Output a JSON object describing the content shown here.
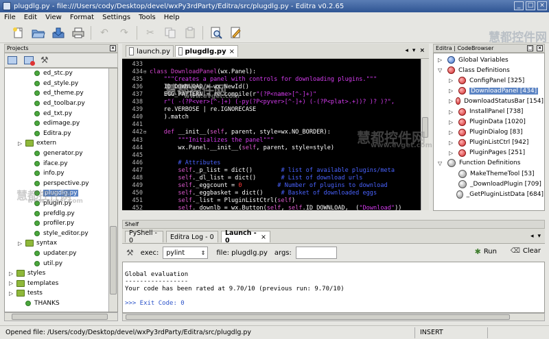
{
  "window": {
    "title": "plugdlg.py - file:///Users/cody/Desktop/devel/wxPy3rdParty/Editra/src/plugdlg.py - Editra v0.2.65"
  },
  "menu": [
    "File",
    "Edit",
    "View",
    "Format",
    "Settings",
    "Tools",
    "Help"
  ],
  "toolbar": {
    "icons": [
      "new-file-icon",
      "open-folder-icon",
      "save-icon",
      "print-icon",
      "undo-icon",
      "redo-icon",
      "cut-icon",
      "copy-icon",
      "paste-icon",
      "find-icon",
      "find-replace-icon"
    ]
  },
  "projects": {
    "title": "Projects",
    "items": [
      {
        "label": "ed_stc.py",
        "type": "py",
        "indent": 3
      },
      {
        "label": "ed_style.py",
        "type": "py",
        "indent": 3
      },
      {
        "label": "ed_theme.py",
        "type": "py",
        "indent": 3
      },
      {
        "label": "ed_toolbar.py",
        "type": "py",
        "indent": 3
      },
      {
        "label": "ed_txt.py",
        "type": "py",
        "indent": 3
      },
      {
        "label": "edimage.py",
        "type": "py",
        "indent": 3
      },
      {
        "label": "Editra.py",
        "type": "py",
        "indent": 3
      },
      {
        "label": "extern",
        "type": "folder",
        "indent": 2
      },
      {
        "label": "generator.py",
        "type": "py",
        "indent": 3
      },
      {
        "label": "iface.py",
        "type": "py",
        "indent": 3
      },
      {
        "label": "info.py",
        "type": "py",
        "indent": 3
      },
      {
        "label": "perspective.py",
        "type": "py",
        "indent": 3
      },
      {
        "label": "plugdlg.py",
        "type": "py",
        "indent": 3,
        "selected": true
      },
      {
        "label": "plugin.py",
        "type": "py",
        "indent": 3
      },
      {
        "label": "prefdlg.py",
        "type": "py",
        "indent": 3
      },
      {
        "label": "profiler.py",
        "type": "py",
        "indent": 3
      },
      {
        "label": "style_editor.py",
        "type": "py",
        "indent": 3
      },
      {
        "label": "syntax",
        "type": "folder",
        "indent": 2
      },
      {
        "label": "updater.py",
        "type": "py",
        "indent": 3
      },
      {
        "label": "util.py",
        "type": "py",
        "indent": 3
      },
      {
        "label": "styles",
        "type": "folder",
        "indent": 1
      },
      {
        "label": "templates",
        "type": "folder",
        "indent": 1
      },
      {
        "label": "tests",
        "type": "folder",
        "indent": 1
      },
      {
        "label": "THANKS",
        "type": "py",
        "indent": 2
      }
    ]
  },
  "editor": {
    "tabs": [
      {
        "label": "launch.py",
        "active": false
      },
      {
        "label": "plugdlg.py",
        "active": true
      }
    ],
    "lines": [
      {
        "n": "433",
        "segs": []
      },
      {
        "n": "434",
        "fold": "⊟",
        "segs": [
          {
            "c": "kw",
            "t": "class "
          },
          {
            "c": "kw",
            "t": "DownloadPanel"
          },
          {
            "c": "pl",
            "t": "(wx.Panel):"
          }
        ]
      },
      {
        "n": "435",
        "segs": [
          {
            "c": "str",
            "t": "    \"\"\"Creates a panel with controls for downloading plugins.\"\"\""
          }
        ]
      },
      {
        "n": "436",
        "segs": [
          {
            "c": "pl",
            "t": "    ID_DOWNLOAD = wx.NewId()"
          }
        ]
      },
      {
        "n": "437",
        "segs": [
          {
            "c": "pl",
            "t": "    EGG_PATTERN = re.compile(r"
          },
          {
            "c": "str",
            "t": "\"(?P<name>[^-]+)\""
          }
        ]
      },
      {
        "n": "438",
        "segs": [
          {
            "c": "str",
            "t": "    r\"( -(?P<ver>[^-]+) (-py(?P<pyver>[^-]+) (-(?P<plat>.+))? )? )?\","
          }
        ]
      },
      {
        "n": "439",
        "segs": [
          {
            "c": "pl",
            "t": "    re.VERBOSE | re.IGNORECASE"
          }
        ]
      },
      {
        "n": "440",
        "segs": [
          {
            "c": "pl",
            "t": "    ).match"
          }
        ]
      },
      {
        "n": "441",
        "segs": []
      },
      {
        "n": "442",
        "fold": "⊟",
        "segs": [
          {
            "c": "kw",
            "t": "    def "
          },
          {
            "c": "pl",
            "t": "__init__("
          },
          {
            "c": "slf",
            "t": "self"
          },
          {
            "c": "pl",
            "t": ", parent, style=wx.NO_BORDER):"
          }
        ]
      },
      {
        "n": "443",
        "segs": [
          {
            "c": "str",
            "t": "        \"\"\"Initializes the panel\"\"\""
          }
        ]
      },
      {
        "n": "444",
        "segs": [
          {
            "c": "pl",
            "t": "        wx.Panel.__init__("
          },
          {
            "c": "slf",
            "t": "self"
          },
          {
            "c": "pl",
            "t": ", parent, style=style)"
          }
        ]
      },
      {
        "n": "445",
        "segs": []
      },
      {
        "n": "446",
        "segs": [
          {
            "c": "cm",
            "t": "        # Attributes"
          }
        ]
      },
      {
        "n": "447",
        "segs": [
          {
            "c": "slf",
            "t": "        self"
          },
          {
            "c": "pl",
            "t": "._p_list = dict()        "
          },
          {
            "c": "cm",
            "t": "# list of available plugins/meta"
          }
        ]
      },
      {
        "n": "448",
        "segs": [
          {
            "c": "slf",
            "t": "        self"
          },
          {
            "c": "pl",
            "t": "._dl_list = dict()       "
          },
          {
            "c": "cm",
            "t": "# List of download urls"
          }
        ]
      },
      {
        "n": "449",
        "segs": [
          {
            "c": "slf",
            "t": "        self"
          },
          {
            "c": "pl",
            "t": "._eggcount = "
          },
          {
            "c": "red",
            "t": "0"
          },
          {
            "c": "pl",
            "t": "          "
          },
          {
            "c": "cm",
            "t": "# Number of plugins to download"
          }
        ]
      },
      {
        "n": "450",
        "segs": [
          {
            "c": "slf",
            "t": "        self"
          },
          {
            "c": "pl",
            "t": "._eggbasket = dict()     "
          },
          {
            "c": "cm",
            "t": "# Basket of downloaded eggs"
          }
        ]
      },
      {
        "n": "451",
        "segs": [
          {
            "c": "slf",
            "t": "        self"
          },
          {
            "c": "pl",
            "t": "._list = PluginListCtrl("
          },
          {
            "c": "slf",
            "t": "self"
          },
          {
            "c": "pl",
            "t": ")"
          }
        ]
      },
      {
        "n": "452",
        "segs": [
          {
            "c": "slf",
            "t": "        self"
          },
          {
            "c": "pl",
            "t": "._downlb = wx.Button("
          },
          {
            "c": "slf",
            "t": "self"
          },
          {
            "c": "pl",
            "t": ", "
          },
          {
            "c": "slf",
            "t": "self"
          },
          {
            "c": "pl",
            "t": ".ID_DOWNLOAD, _("
          },
          {
            "c": "str",
            "t": "\"Download\""
          },
          {
            "c": "pl",
            "t": "))"
          }
        ]
      }
    ]
  },
  "browser": {
    "title": "Editra | CodeBrowser",
    "items": [
      {
        "label": "Global Variables",
        "kind": "globe",
        "indent": 0,
        "arrow": "▷"
      },
      {
        "label": "Class Definitions",
        "kind": "class",
        "indent": 0,
        "arrow": "▽"
      },
      {
        "label": "ConfigPanel [325]",
        "kind": "ball",
        "indent": 1,
        "arrow": "▷"
      },
      {
        "label": "DownloadPanel [434]",
        "kind": "ball",
        "indent": 1,
        "arrow": "▷",
        "selected": true
      },
      {
        "label": "DownloadStatusBar [154]",
        "kind": "ball",
        "indent": 1,
        "arrow": "▷"
      },
      {
        "label": "InstallPanel [738]",
        "kind": "ball",
        "indent": 1,
        "arrow": "▷"
      },
      {
        "label": "PluginData [1020]",
        "kind": "ball",
        "indent": 1,
        "arrow": "▷"
      },
      {
        "label": "PluginDialog [83]",
        "kind": "ball",
        "indent": 1,
        "arrow": "▷"
      },
      {
        "label": "PluginListCtrl [942]",
        "kind": "ball",
        "indent": 1,
        "arrow": "▷"
      },
      {
        "label": "PluginPages [251]",
        "kind": "ball",
        "indent": 1,
        "arrow": "▷"
      },
      {
        "label": "Function Definitions",
        "kind": "fngroup",
        "indent": 0,
        "arrow": "▽"
      },
      {
        "label": "MakeThemeTool [53]",
        "kind": "fn",
        "indent": 1,
        "arrow": ""
      },
      {
        "label": "_DownloadPlugin [709]",
        "kind": "fn",
        "indent": 1,
        "arrow": ""
      },
      {
        "label": "_GetPluginListData [684]",
        "kind": "fn",
        "indent": 1,
        "arrow": ""
      }
    ]
  },
  "shelf": {
    "title": "Shelf",
    "tabs": [
      {
        "label": "PyShell - 0",
        "active": false
      },
      {
        "label": "Editra Log - 0",
        "active": false
      },
      {
        "label": "Launch - 0",
        "active": true
      }
    ],
    "exec_label": "exec:",
    "exec_value": "pylint",
    "file_label": "file: plugdlg.py",
    "args_label": "args:",
    "args_value": "",
    "run_label": "Run",
    "clear_label": "Clear",
    "output": [
      "",
      "Global evaluation",
      "-----------------",
      "Your code has been rated at 9.70/10 (previous run: 9.70/10)",
      "",
      ">>> Exit Code: 0"
    ]
  },
  "status": {
    "left": "Opened file: /Users/cody/Desktop/devel/wxPy3rdParty/Editra/src/plugdlg.py",
    "mode": "INSERT"
  },
  "watermark": {
    "zh": "慧都控件网",
    "url": "www.evget.com"
  }
}
